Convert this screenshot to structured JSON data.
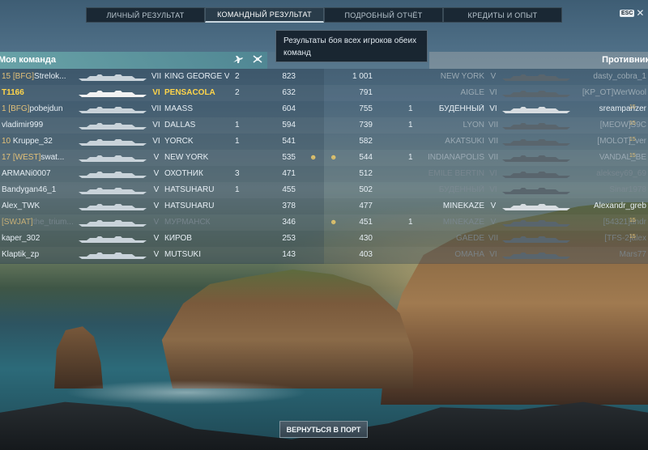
{
  "tabs": [
    {
      "label": "ЛИЧНЫЙ РЕЗУЛЬТАТ",
      "active": false
    },
    {
      "label": "КОМАНДНЫЙ РЕЗУЛЬТАТ",
      "active": true
    },
    {
      "label": "ПОДРОБНЫЙ ОТЧЁТ",
      "active": false
    },
    {
      "label": "КРЕДИТЫ И ОПЫТ",
      "active": false
    }
  ],
  "esc": {
    "label": "ESC",
    "close": "✕"
  },
  "tooltip": "Результаты боя всех игроков обеих команд",
  "my_team": {
    "title": "Моя команда",
    "icons": {
      "kills": "plane-icon",
      "planes": "plane-shot-icon"
    }
  },
  "enemy_team": {
    "title": "Противник"
  },
  "colors": {
    "highlight": "#ffd54a",
    "clan": "#e2c079",
    "header_left": "#6caaac"
  },
  "rows": [
    {
      "l_rank": "15",
      "l_clan": "[BFG]",
      "l_name": "Strelok...",
      "l_tier": "VII",
      "l_ship": "KING GEORGE V",
      "l_kills": "2",
      "l_exp": "823",
      "medal1": "",
      "medal2": "",
      "r_exp": "1 001",
      "r_kills": "",
      "r_ship": "NEW YORK",
      "r_tier": "V",
      "r_name": "dasty_cobra_1",
      "r_rank": "",
      "l_class": "",
      "r_class": "dim"
    },
    {
      "l_rank": "",
      "l_clan": "",
      "l_name": "T1166",
      "l_tier": "VI",
      "l_ship": "PENSACOLA",
      "l_kills": "2",
      "l_exp": "632",
      "medal1": "",
      "medal2": "",
      "r_exp": "791",
      "r_kills": "",
      "r_ship": "AIGLE",
      "r_tier": "VI",
      "r_name": "[KP_OT]WerWool",
      "r_rank": "",
      "l_class": "hl",
      "r_class": "dim"
    },
    {
      "l_rank": "1",
      "l_clan": "[BFG]",
      "l_name": "pobejdun",
      "l_tier": "VII",
      "l_ship": "MAASS",
      "l_kills": "",
      "l_exp": "604",
      "medal1": "",
      "medal2": "",
      "r_exp": "755",
      "r_kills": "1",
      "r_ship": "БУДЁННЫЙ",
      "r_tier": "VI",
      "r_name": "sreampanzer",
      "r_rank": "15",
      "l_class": "",
      "r_class": ""
    },
    {
      "l_rank": "",
      "l_clan": "",
      "l_name": "vladimir999",
      "l_tier": "VI",
      "l_ship": "DALLAS",
      "l_kills": "1",
      "l_exp": "594",
      "medal1": "",
      "medal2": "",
      "r_exp": "739",
      "r_kills": "1",
      "r_ship": "LYON",
      "r_tier": "VII",
      "r_name": "[MEOW]S9C",
      "r_rank": "15",
      "l_class": "",
      "r_class": "dim"
    },
    {
      "l_rank": "10",
      "l_clan": "",
      "l_name": "Kruppe_32",
      "l_tier": "VI",
      "l_ship": "YORCK",
      "l_kills": "1",
      "l_exp": "541",
      "medal1": "",
      "medal2": "",
      "r_exp": "582",
      "r_kills": "",
      "r_ship": "AKATSUKI",
      "r_tier": "VII",
      "r_name": "[MOLOT]_ver",
      "r_rank": "15",
      "l_class": "",
      "r_class": "dim"
    },
    {
      "l_rank": "17",
      "l_clan": "[WEST]",
      "l_name": "swat...",
      "l_tier": "V",
      "l_ship": "NEW YORK",
      "l_kills": "",
      "l_exp": "535",
      "medal1": "☻",
      "medal2": "☻",
      "r_exp": "544",
      "r_kills": "1",
      "r_ship": "INDIANAPOLIS",
      "r_tier": "VII",
      "r_name": "VANDAL_BE",
      "r_rank": "15",
      "l_class": "",
      "r_class": "dim"
    },
    {
      "l_rank": "",
      "l_clan": "",
      "l_name": "ARMANi0007",
      "l_tier": "V",
      "l_ship": "ОХОТНИК",
      "l_kills": "3",
      "l_exp": "471",
      "medal1": "",
      "medal2": "",
      "r_exp": "512",
      "r_kills": "",
      "r_ship": "EMILE BERTIN",
      "r_tier": "VI",
      "r_name": "aleksey69_69",
      "r_rank": "",
      "l_class": "",
      "r_class": "dim2"
    },
    {
      "l_rank": "",
      "l_clan": "",
      "l_name": "Bandygan46_1",
      "l_tier": "V",
      "l_ship": "HATSUHARU",
      "l_kills": "1",
      "l_exp": "455",
      "medal1": "",
      "medal2": "",
      "r_exp": "502",
      "r_kills": "",
      "r_ship": "БУДЁННЫЙ",
      "r_tier": "VI",
      "r_name": "Sinar1978",
      "r_rank": "",
      "l_class": "",
      "r_class": "dim2"
    },
    {
      "l_rank": "",
      "l_clan": "",
      "l_name": "Alex_TWK",
      "l_tier": "V",
      "l_ship": "HATSUHARU",
      "l_kills": "",
      "l_exp": "378",
      "medal1": "",
      "medal2": "",
      "r_exp": "477",
      "r_kills": "",
      "r_ship": "MINEKAZE",
      "r_tier": "V",
      "r_name": "Alexandr_greb",
      "r_rank": "",
      "l_class": "",
      "r_class": ""
    },
    {
      "l_rank": "",
      "l_clan": "[SWJAT]",
      "l_name": "the_trium...",
      "l_tier": "V",
      "l_ship": "МУРМАНСК",
      "l_kills": "",
      "l_exp": "346",
      "medal1": "",
      "medal2": "☻",
      "r_exp": "451",
      "r_kills": "1",
      "r_ship": "MINEKAZE",
      "r_tier": "V",
      "r_name": "[54321]andr",
      "r_rank": "15",
      "l_class": "dim2",
      "r_class": "dim2"
    },
    {
      "l_rank": "",
      "l_clan": "",
      "l_name": "kaper_302",
      "l_tier": "V",
      "l_ship": "КИРОВ",
      "l_kills": "",
      "l_exp": "253",
      "medal1": "",
      "medal2": "",
      "r_exp": "430",
      "r_kills": "",
      "r_ship": "GAEDE",
      "r_tier": "VII",
      "r_name": "[TFS-2]alex",
      "r_rank": "15",
      "l_class": "",
      "r_class": "dim2"
    },
    {
      "l_rank": "",
      "l_clan": "",
      "l_name": "Klaptik_zp",
      "l_tier": "V",
      "l_ship": "MUTSUKI",
      "l_kills": "",
      "l_exp": "143",
      "medal1": "",
      "medal2": "",
      "r_exp": "403",
      "r_kills": "",
      "r_ship": "OMAHA",
      "r_tier": "VI",
      "r_name": "Mars77",
      "r_rank": "",
      "l_class": "",
      "r_class": "dim2"
    }
  ],
  "port_button": "ВЕРНУТЬСЯ В ПОРТ"
}
